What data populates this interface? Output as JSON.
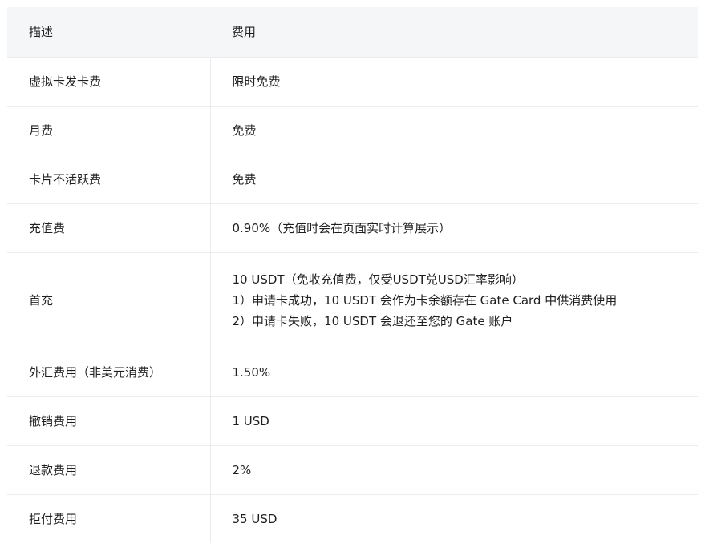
{
  "table": {
    "headers": [
      "描述",
      "费用"
    ],
    "rows": [
      {
        "desc": "虚拟卡发卡费",
        "fee": [
          "限时免费"
        ]
      },
      {
        "desc": "月费",
        "fee": [
          "免费"
        ]
      },
      {
        "desc": "卡片不活跃费",
        "fee": [
          "免费"
        ]
      },
      {
        "desc": "充值费",
        "fee": [
          "0.90%（充值时会在页面实时计算展示）"
        ]
      },
      {
        "desc": "首充",
        "fee": [
          "10 USDT（免收充值费，仅受USDT兑USD汇率影响）",
          "1）申请卡成功，10 USDT 会作为卡余额存在 Gate Card 中供消费使用",
          "2）申请卡失败，10 USDT 会退还至您的 Gate 账户"
        ]
      },
      {
        "desc": "外汇费用（非美元消费）",
        "fee": [
          "1.50%"
        ]
      },
      {
        "desc": "撤销费用",
        "fee": [
          "1 USD"
        ]
      },
      {
        "desc": "退款费用",
        "fee": [
          "2%"
        ]
      },
      {
        "desc": "拒付费用",
        "fee": [
          "35 USD"
        ]
      }
    ]
  }
}
